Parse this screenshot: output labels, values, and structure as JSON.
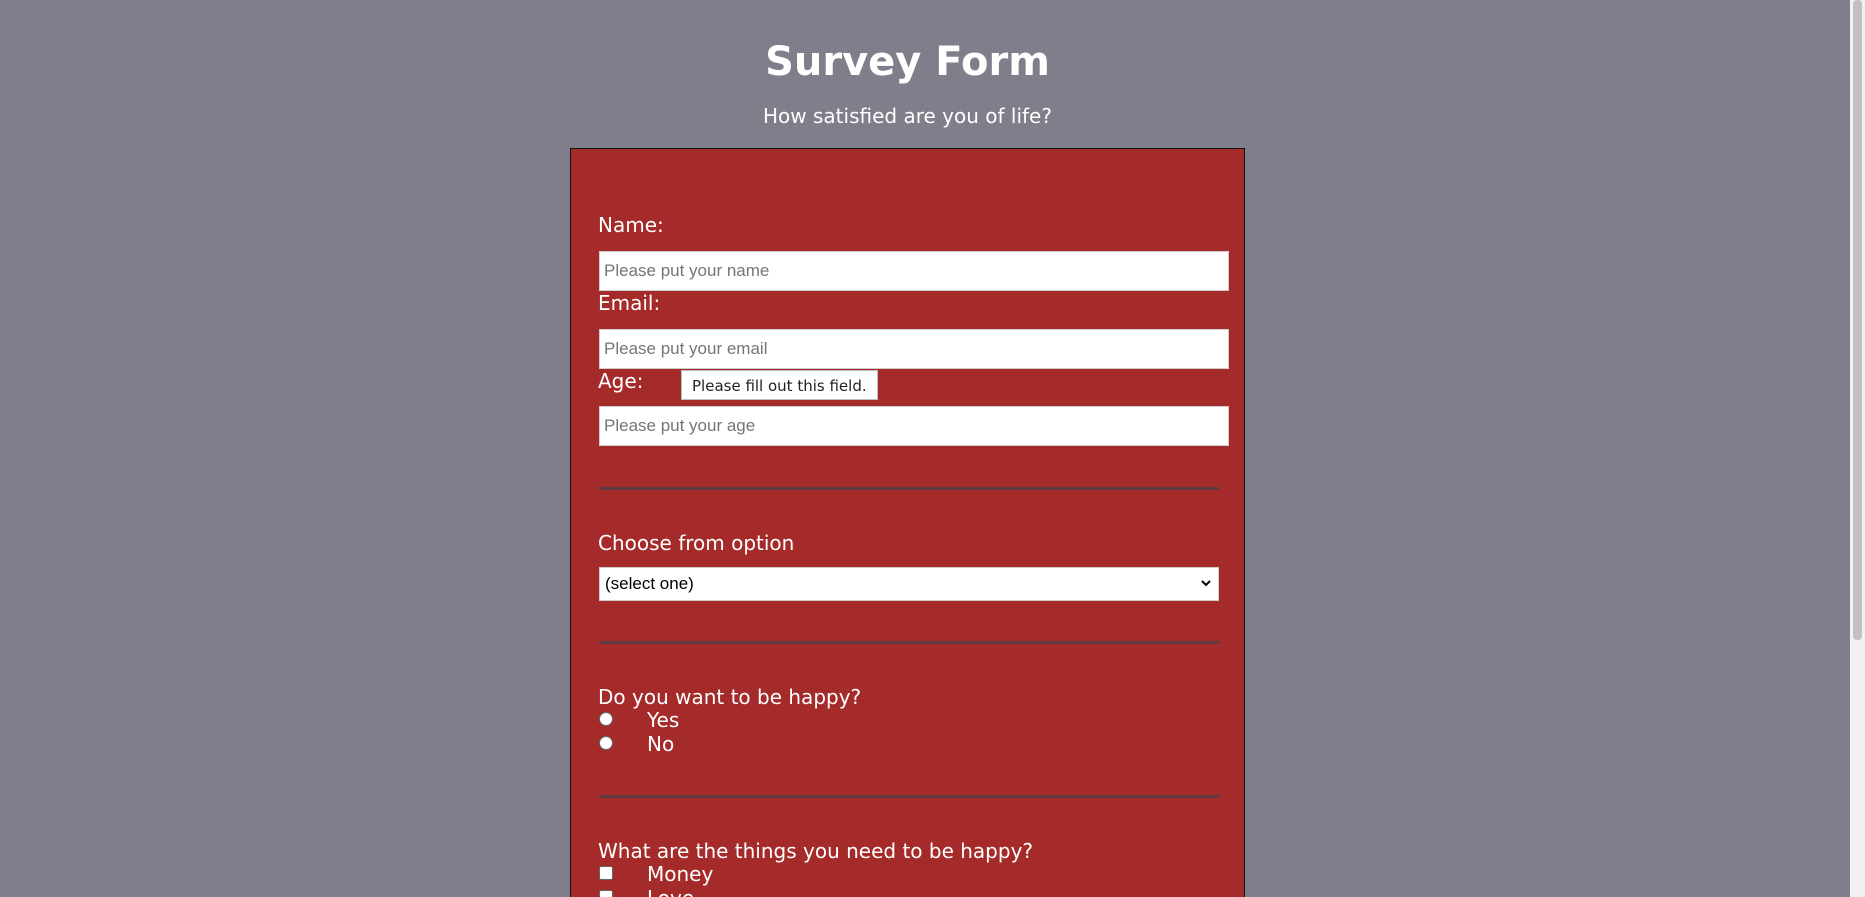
{
  "header": {
    "title": "Survey Form",
    "subtitle": "How satisfied are you of life?"
  },
  "form": {
    "name_label": "Name:",
    "name_placeholder": "Please put your name",
    "email_label": "Email:",
    "email_placeholder": "Please put your email",
    "age_label": "Age:",
    "age_placeholder": "Please put your age",
    "validation_tooltip": "Please fill out this field.",
    "dropdown_label": "Choose from option",
    "dropdown_selected": "(select one)",
    "happy_question": "Do you want to be happy?",
    "happy_options": [
      "Yes",
      "No"
    ],
    "needs_question": "What are the things you need to be happy?",
    "needs_options": [
      "Money",
      "Love"
    ]
  },
  "colors": {
    "background": "#7e7f8a",
    "form_panel": "#a52a2a",
    "divider": "#5e3b44"
  },
  "icons": {
    "dropdown": "chevron-down-icon"
  }
}
